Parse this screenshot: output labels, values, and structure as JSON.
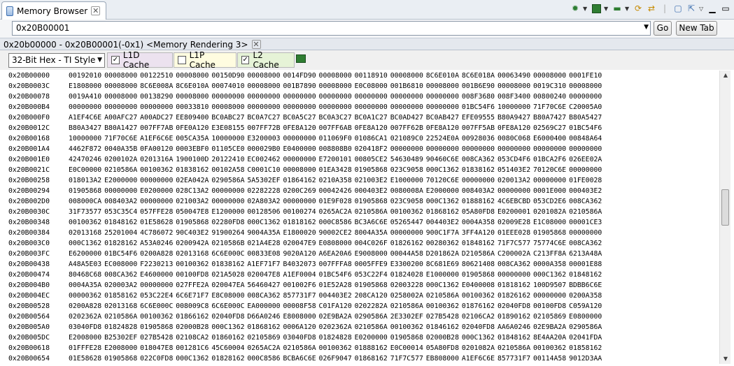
{
  "view": {
    "title": "Memory Browser"
  },
  "address_bar": {
    "value": "0x20B00001",
    "go_label": "Go",
    "new_tab_label": "New Tab"
  },
  "rendering_tab": {
    "title": "0x20b00000 - 0x20B00001(-0x1) <Memory Rendering 3>"
  },
  "options": {
    "format": "32-Bit Hex - TI Style",
    "l1d": {
      "label": "L1D Cache",
      "checked": true
    },
    "l1p": {
      "label": "L1P Cache",
      "checked": false
    },
    "l2": {
      "label": "L2 Cache",
      "checked": true
    }
  },
  "colors": {
    "l1d_bg": "#ece2ef",
    "l1p_bg": "#fffce0",
    "l2_bg": "#e6f3d7"
  },
  "memory": {
    "rows": [
      {
        "addr": "0x20B00000",
        "words": [
          "00192010",
          "00008000",
          "00122510",
          "00008000",
          "00150D90",
          "00008000",
          "0014FD90",
          "00008000",
          "00118910",
          "00008000",
          "8C6E010A",
          "8C6E018A",
          "00063490",
          "00008000",
          "0001FE10"
        ]
      },
      {
        "addr": "0x20B0003C",
        "words": [
          "E1808000",
          "00008000",
          "8C6E008A",
          "8C6E010A",
          "00074010",
          "00008000",
          "001B7890",
          "00008000",
          "E0C08000",
          "001B6810",
          "00008000",
          "001B6E90",
          "00008000",
          "0019C310",
          "00008000"
        ]
      },
      {
        "addr": "0x20B00078",
        "words": [
          "0019A410",
          "00008000",
          "00138290",
          "00008000",
          "00000000",
          "00000000",
          "00000000",
          "00000000",
          "00000000",
          "00000000",
          "00000000",
          "008F3680",
          "008F3400",
          "00800240",
          "00000000"
        ]
      },
      {
        "addr": "0x20B000B4",
        "words": [
          "00000000",
          "00000000",
          "00000000",
          "00033810",
          "00008000",
          "00000000",
          "00000000",
          "00000000",
          "00000000",
          "00000000",
          "00000000",
          "01BC54F6",
          "10000000",
          "71F70C6E",
          "C20005A0"
        ]
      },
      {
        "addr": "0x20B000F0",
        "words": [
          "A1EF4C6E",
          "A00AFC27",
          "A00ADC27",
          "EE809400",
          "BC0ABC27",
          "BC0A7C27",
          "BC0A5C27",
          "BC0A3C27",
          "BC0A1C27",
          "BC0AD427",
          "BC0AB427",
          "EFE09555",
          "B80A9427",
          "B80A7427",
          "B80A5427"
        ]
      },
      {
        "addr": "0x20B0012C",
        "words": [
          "B80A3427",
          "B80A1427",
          "007FF7AB",
          "0FE0A120",
          "E3E08155",
          "007FF72B",
          "0FE8A120",
          "007FF6AB",
          "0FE8A120",
          "007FF62B",
          "0FE8A120",
          "007FF5AB",
          "0FE8A120",
          "02569C27",
          "01BC54F6"
        ]
      },
      {
        "addr": "0x20B00168",
        "words": [
          "10000000",
          "71F70C6E",
          "A1EF6C6E",
          "005CA35A",
          "10000000",
          "E3200003",
          "00000000",
          "011069F0",
          "01086CA1",
          "021089C0",
          "22524E0A",
          "00928036",
          "0080C068",
          "E6000400",
          "00848A64"
        ]
      },
      {
        "addr": "0x20B001A4",
        "words": [
          "4462F872",
          "0040A35B",
          "0FA00120",
          "0003EBF0",
          "01105CE0",
          "000029B0",
          "E0400000",
          "008808B0",
          "020418F2",
          "00000000",
          "00000000",
          "00000000",
          "00000000",
          "00000000",
          "00000000"
        ]
      },
      {
        "addr": "0x20B001E0",
        "words": [
          "42470246",
          "0200102A",
          "0201316A",
          "1900100D",
          "20122410",
          "EC002462",
          "00000000",
          "E7200101",
          "00805CE2",
          "54630489",
          "90460C6E",
          "008CA362",
          "053CD4F6",
          "01BCA2F6",
          "026EE02A"
        ]
      },
      {
        "addr": "0x20B0021C",
        "words": [
          "E0C00000",
          "0210586A",
          "00100362",
          "01838162",
          "00102A58",
          "C0001C10",
          "00008000",
          "01EA3428",
          "01905868",
          "023C9058",
          "000C1362",
          "01838162",
          "051403E2",
          "70120C6E",
          "00000000"
        ]
      },
      {
        "addr": "0x20B00258",
        "words": [
          "018013A2",
          "E2000000",
          "00000000",
          "02EA042A",
          "0290586A",
          "5A5302EF",
          "01864162",
          "0210A358",
          "021003E2",
          "E1000000",
          "70120C6E",
          "00000000",
          "020013A2",
          "00000000",
          "01FE0028"
        ]
      },
      {
        "addr": "0x20B00294",
        "words": [
          "01905868",
          "00000000",
          "E0200000",
          "028C13A2",
          "00000000",
          "02282228",
          "0200C269",
          "00042426",
          "000403E2",
          "0080008A",
          "E2000000",
          "008403A2",
          "00000000",
          "0001E000",
          "000403E2"
        ]
      },
      {
        "addr": "0x20B002D0",
        "words": [
          "008000CA",
          "008403A2",
          "00000000",
          "021003A2",
          "00000000",
          "02A803A2",
          "00000000",
          "01E9F028",
          "01905868",
          "023C9058",
          "000C1362",
          "01888162",
          "4C6EBCBD",
          "053CD2E6",
          "008CA362"
        ]
      },
      {
        "addr": "0x20B0030C",
        "words": [
          "31F73577",
          "053C35C4",
          "057FFE28",
          "050047E8",
          "E1200000",
          "00128506",
          "00100274",
          "0265AC2A",
          "0210586A",
          "00100362",
          "01868162",
          "05A80FD8",
          "E0200001",
          "0201082A",
          "0210586A"
        ]
      },
      {
        "addr": "0x20B00348",
        "words": [
          "00100362",
          "01848162",
          "01E58628",
          "01905868",
          "02280FD8",
          "000C1362",
          "01818162",
          "000C8586",
          "BC3A6C6E",
          "05265447",
          "004403E2",
          "0004A358",
          "02009E28",
          "E1C08000",
          "00001CE3"
        ]
      },
      {
        "addr": "0x20B00384",
        "words": [
          "02013168",
          "25201004",
          "4C786072",
          "90C403E2",
          "91900264",
          "9004A35A",
          "E1800020",
          "90002CE2",
          "8004A35A",
          "00000000",
          "900C1F7A",
          "3FF4A120",
          "01EEE028",
          "01905868",
          "00000000"
        ]
      },
      {
        "addr": "0x20B003C0",
        "words": [
          "000C1362",
          "01828162",
          "A53A0246",
          "0200942A",
          "0210586B",
          "021A4E28",
          "020047E9",
          "E0808000",
          "004C026F",
          "01826162",
          "00280362",
          "01848162",
          "71F7C577",
          "75774C6E",
          "008CA362"
        ]
      },
      {
        "addr": "0x20B003FC",
        "words": [
          "E6200000",
          "01BC54F6",
          "0200A828",
          "02013168",
          "6C6E000C",
          "00833E08",
          "9020A120",
          "A6EA20A6",
          "E9008000",
          "00044A58",
          "D201862A",
          "D210586A",
          "C200002A",
          "C213FF8A",
          "6213A48A"
        ]
      },
      {
        "addr": "0x20B00438",
        "words": [
          "A48A5E03",
          "EC008000",
          "F2230213",
          "00100362",
          "01838162",
          "A1EF71F7",
          "B4032073",
          "007FFFA8",
          "0005FFE9",
          "E3300200",
          "8C681E69",
          "80621408",
          "008CA362",
          "0000A358",
          "00001E88"
        ]
      },
      {
        "addr": "0x20B00474",
        "words": [
          "80468C68",
          "008CA362",
          "E4600000",
          "00100FD8",
          "021A5028",
          "020047E8",
          "A1EF0004",
          "01BC54F6",
          "053C22F4",
          "01824028",
          "E1000000",
          "01905868",
          "00000000",
          "000C1362",
          "01848162"
        ]
      },
      {
        "addr": "0x20B004B0",
        "words": [
          "0004A35A",
          "020003A2",
          "00000000",
          "027FFE2A",
          "020047EA",
          "56460427",
          "001002F6",
          "01E52A28",
          "01905868",
          "02003228",
          "000C1362",
          "E0400008",
          "01818162",
          "100D9507",
          "BDBB6C6E"
        ]
      },
      {
        "addr": "0x20B004EC",
        "words": [
          "00000362",
          "01858162",
          "053C22E4",
          "6C6E71F7",
          "E8C08000",
          "008CA362",
          "857731F7",
          "004403E2",
          "208CA120",
          "0258002A",
          "0210586A",
          "00100362",
          "01826162",
          "00000000",
          "0200A358"
        ]
      },
      {
        "addr": "0x20B00528",
        "words": [
          "0200A828",
          "02013168",
          "6C6E000C",
          "008009C8",
          "6C6E000C",
          "EA000000",
          "00008F58",
          "C01FA120",
          "0202282A",
          "0210586A",
          "00100362",
          "01876162",
          "02040FD8",
          "00100FD8",
          "C059A120"
        ]
      },
      {
        "addr": "0x20B00564",
        "words": [
          "0202362A",
          "0210586A",
          "00100362",
          "01866162",
          "02040FD8",
          "D66A0246",
          "E8008000",
          "02E9BA2A",
          "0290586A",
          "2E3302EF",
          "027B5428",
          "02106CA2",
          "01890162",
          "02105869",
          "E0800000"
        ]
      },
      {
        "addr": "0x20B005A0",
        "words": [
          "03040FD8",
          "01824828",
          "01905868",
          "02000B28",
          "000C1362",
          "01868162",
          "0006A120",
          "0202362A",
          "0210586A",
          "00100362",
          "01846162",
          "02040FD8",
          "AA6A0246",
          "02E9BA2A",
          "0290586A"
        ]
      },
      {
        "addr": "0x20B005DC",
        "words": [
          "E2008000",
          "B25302EF",
          "027B5428",
          "02108CA2",
          "01860162",
          "02105869",
          "03040FD8",
          "01824828",
          "E0200000",
          "01905868",
          "02000B28",
          "000C1362",
          "01848162",
          "8E4AA20A",
          "02041FDA"
        ]
      },
      {
        "addr": "0x20B00618",
        "words": [
          "01FFFE28",
          "E2008000",
          "018047E8",
          "001281C6",
          "45C60004",
          "0265AC2A",
          "0210586A",
          "00100362",
          "01888162",
          "E0C00014",
          "05A80FD8",
          "0201082A",
          "0210586A",
          "00100362",
          "01858162"
        ]
      },
      {
        "addr": "0x20B00654",
        "words": [
          "01E58628",
          "01905868",
          "022C0FD8",
          "000C1362",
          "01828162",
          "000C8586",
          "BCBA6C6E",
          "026F9047",
          "01868162",
          "71F7C577",
          "EB808000",
          "A1EF6C6E",
          "857731F7",
          "00114A58",
          "9012D3AA"
        ]
      }
    ]
  }
}
